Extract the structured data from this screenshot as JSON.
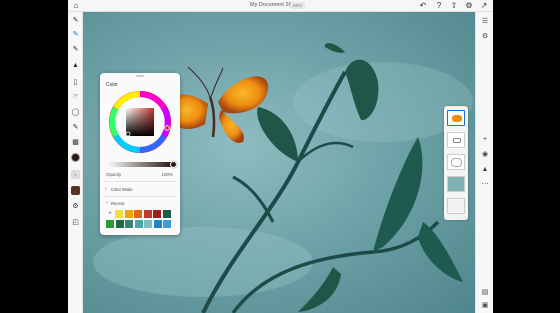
{
  "document": {
    "title": "My Document 26",
    "zoom": "59%"
  },
  "color_panel": {
    "title": "Color",
    "opacity_label": "Opacity",
    "opacity_value": "100%",
    "color_mode_label": "Color Mode",
    "recent_label": "Recent",
    "current_color": "#2a1a16",
    "hue_color": "#c0392b"
  },
  "recent_colors_row1": [
    "#f3df3c",
    "#f2a30e",
    "#e0651d",
    "#c0392b",
    "#9c1f1f",
    "#1e5c4a"
  ],
  "recent_colors_row2": [
    "#2e9a3c",
    "#1c6b44",
    "#3d7f79",
    "#4aa7a8",
    "#7dbbc7",
    "#1f86c9",
    "#3f9fd4"
  ],
  "toolbar_icons": [
    "pixel-brush-icon",
    "live-brush-icon",
    "vector-brush-icon",
    "fill-icon",
    "eraser-icon",
    "smudge-icon",
    "selection-icon",
    "transform-icon",
    "eyedropper-icon",
    "image-icon"
  ],
  "right_toolbar_icons": [
    "layers-icon",
    "properties-icon"
  ],
  "layers": [
    "butterfly-layer",
    "sketch-layer",
    "leaves-layer",
    "background-layer",
    "texture-layer"
  ]
}
